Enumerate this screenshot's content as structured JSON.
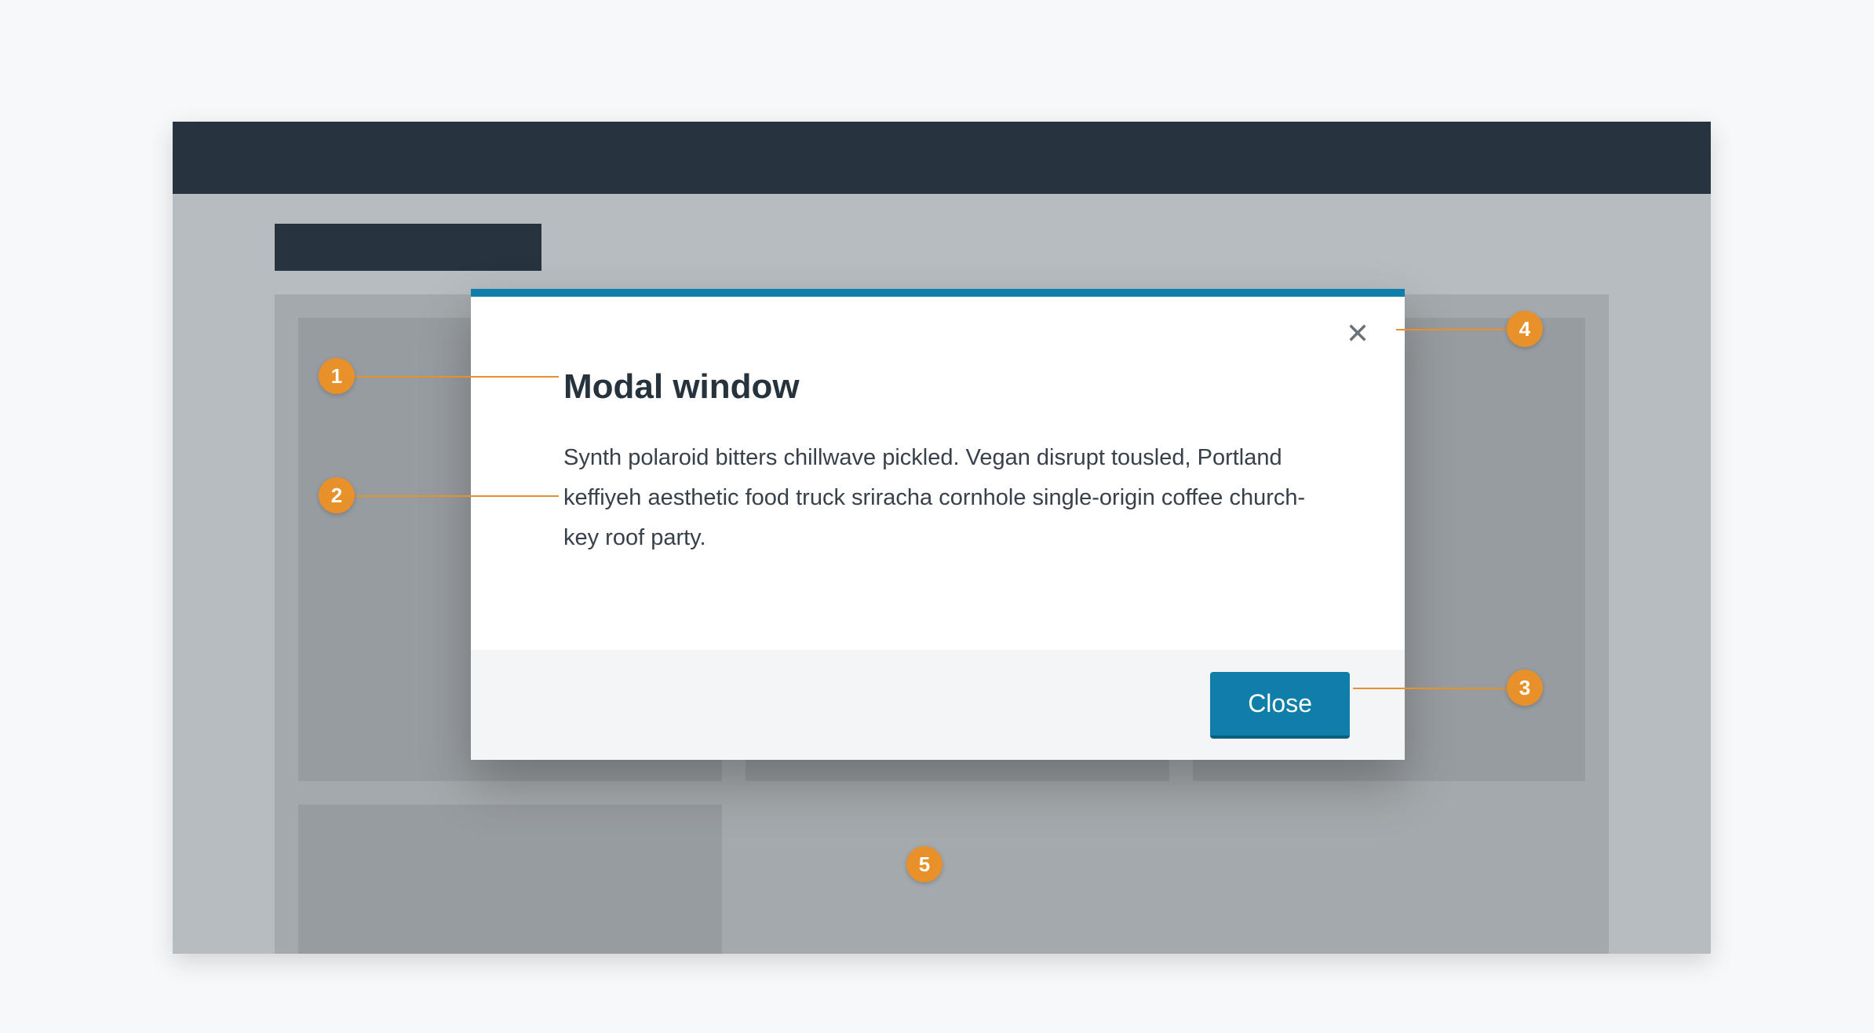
{
  "modal": {
    "title": "Modal window",
    "body": "Synth polaroid bitters chillwave pickled. Vegan disrupt tousled, Portland keffiyeh aesthetic food truck sriracha cornhole single-origin coffee church-key roof party.",
    "close_button_label": "Close"
  },
  "callouts": {
    "c1": "1",
    "c2": "2",
    "c3": "3",
    "c4": "4",
    "c5": "5"
  }
}
